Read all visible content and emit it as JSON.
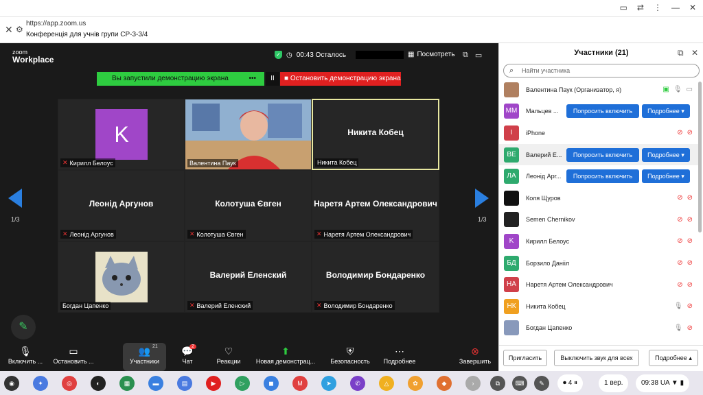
{
  "browser": {
    "url": "https://app.zoom.us",
    "title": "Конференція для учнів групи СР-3-3/4"
  },
  "zoom": {
    "logo_top": "zoom",
    "logo_bottom": "Workplace",
    "timer": "00:43 Осталось",
    "view_label": "Посмотреть",
    "share_banner": "Вы запустили демонстрацию экрана",
    "share_dots": "•••",
    "pause_icon": "II",
    "stop_share": "Остановить демонстрацию экрана",
    "page_left": "1/3",
    "page_right": "1/3",
    "tiles": [
      {
        "name": "Кирилл Белоус",
        "avatar": "K",
        "type": "avatar"
      },
      {
        "name": "Валентина Паук",
        "type": "video"
      },
      {
        "name": "Никита Кобец",
        "center": "Никита Кобец",
        "type": "text"
      },
      {
        "name": "Леонід Аргунов",
        "center": "Леонід Аргунов",
        "type": "text"
      },
      {
        "name": "Колотуша Євген",
        "center": "Колотуша Євген",
        "type": "text"
      },
      {
        "name": "Наретя Артем Олександрович",
        "center": "Наретя Артем Олександрович",
        "type": "text"
      },
      {
        "name": "Богдан Цапенко",
        "type": "cat"
      },
      {
        "name": "Валерий Еленский",
        "center": "Валерий Еленский",
        "type": "text"
      },
      {
        "name": "Володимир Бондаренко",
        "center": "Володимир Бондаренко",
        "type": "text"
      }
    ],
    "toolbar": {
      "unmute": "Включить ...",
      "stop_video": "Остановить ...",
      "participants": "Участники",
      "participants_count": "21",
      "chat": "Чат",
      "chat_badge": "2",
      "reactions": "Реакции",
      "new_share": "Новая демонстрац...",
      "security": "Безопасность",
      "more": "Подробнее",
      "end": "Завершить"
    }
  },
  "panel": {
    "title": "Участники (21)",
    "search_placeholder": "Найти участника",
    "ask_label": "Попросить включить",
    "more_label": "Подробнее ▾",
    "participants": [
      {
        "name": "Валентина Паук (Организатор, я)",
        "initials": "",
        "color": "#b08060"
      },
      {
        "name": "Мальцев ...",
        "initials": "ММ",
        "color": "#a046c8"
      },
      {
        "name": "iPhone",
        "initials": "I",
        "color": "#d0404a"
      },
      {
        "name": "Валерий Е...",
        "initials": "ВЕ",
        "color": "#2eaa6e"
      },
      {
        "name": "Леонід Арг...",
        "initials": "ЛА",
        "color": "#2eaa6e"
      },
      {
        "name": "Коля Щуров",
        "initials": "",
        "color": "#111111"
      },
      {
        "name": "Semen Chernikov",
        "initials": "",
        "color": "#222222"
      },
      {
        "name": "Кирилл Белоус",
        "initials": "K",
        "color": "#a046c8"
      },
      {
        "name": "Борзило Данііл",
        "initials": "БД",
        "color": "#2eaa6e"
      },
      {
        "name": "Наретя Артем Олександрович",
        "initials": "НА",
        "color": "#d0404a"
      },
      {
        "name": "Никита Кобец",
        "initials": "НК",
        "color": "#f0a020"
      },
      {
        "name": "Богдан Цапенко",
        "initials": "",
        "color": "#8899bb"
      }
    ],
    "invite": "Пригласить",
    "mute_all": "Выключить звук для всех",
    "more_footer": "Подробнее ▴"
  },
  "shelf": {
    "lang_bubble": "1 вер.",
    "time": "09:38",
    "locale": "UA",
    "notif": "4"
  }
}
